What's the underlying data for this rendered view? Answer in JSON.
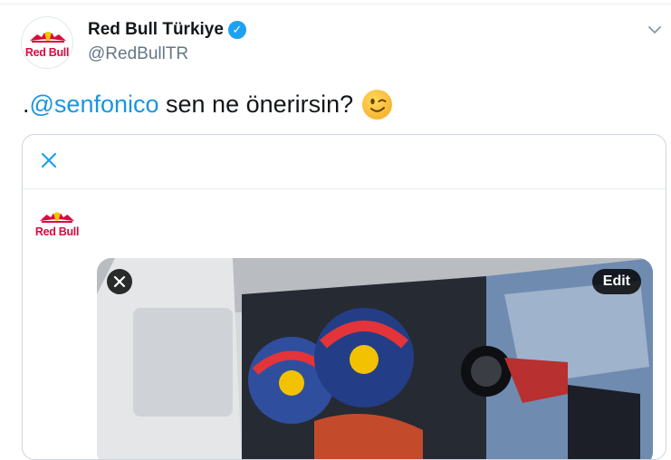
{
  "tweet": {
    "author_name": "Red Bull Türkiye",
    "handle": "@RedBullTR",
    "text_prefix": ".",
    "mention": "@senfonico",
    "text_suffix": " sen ne önerirsin?",
    "emoji": "winking-face"
  },
  "avatar": {
    "logo_text": "Red Bull"
  },
  "card": {
    "avatar_logo_text": "Red Bull",
    "media": {
      "edit_label": "Edit"
    }
  },
  "colors": {
    "link": "#1b95e0",
    "verified": "#1da1f2",
    "brand_red": "#db0a40",
    "brand_yellow": "#f5c400"
  }
}
